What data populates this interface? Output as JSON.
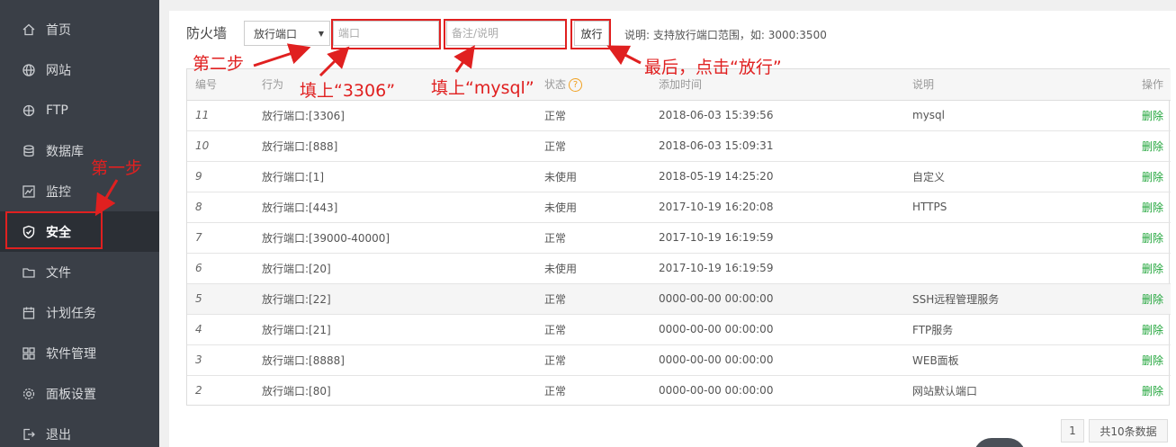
{
  "sidebar": {
    "items": [
      {
        "label": "首页",
        "icon": "home-icon"
      },
      {
        "label": "网站",
        "icon": "globe-icon"
      },
      {
        "label": "FTP",
        "icon": "ftp-icon"
      },
      {
        "label": "数据库",
        "icon": "database-icon"
      },
      {
        "label": "监控",
        "icon": "monitor-icon"
      },
      {
        "label": "安全",
        "icon": "shield-icon",
        "active": true
      },
      {
        "label": "文件",
        "icon": "folder-icon"
      },
      {
        "label": "计划任务",
        "icon": "calendar-icon"
      },
      {
        "label": "软件管理",
        "icon": "grid-icon"
      },
      {
        "label": "面板设置",
        "icon": "gear-icon"
      },
      {
        "label": "退出",
        "icon": "logout-icon"
      }
    ]
  },
  "toolbar": {
    "title": "防火墙",
    "select_value": "放行端口",
    "port_placeholder": "端口",
    "remark_placeholder": "备注/说明",
    "allow_label": "放行",
    "hint": "说明: 支持放行端口范围，如: 3000:3500"
  },
  "table": {
    "headers": [
      "编号",
      "行为",
      "状态",
      "添加时间",
      "说明",
      "操作"
    ],
    "rows": [
      {
        "id": "11",
        "action": "放行端口:[3306]",
        "status": "正常",
        "time": "2018-06-03 15:39:56",
        "remark": "mysql",
        "op": "删除"
      },
      {
        "id": "10",
        "action": "放行端口:[888]",
        "status": "正常",
        "time": "2018-06-03 15:09:31",
        "remark": "",
        "op": "删除"
      },
      {
        "id": "9",
        "action": "放行端口:[1]",
        "status": "未使用",
        "time": "2018-05-19 14:25:20",
        "remark": "自定义",
        "op": "删除"
      },
      {
        "id": "8",
        "action": "放行端口:[443]",
        "status": "未使用",
        "time": "2017-10-19 16:20:08",
        "remark": "HTTPS",
        "op": "删除"
      },
      {
        "id": "7",
        "action": "放行端口:[39000-40000]",
        "status": "正常",
        "time": "2017-10-19 16:19:59",
        "remark": "",
        "op": "删除"
      },
      {
        "id": "6",
        "action": "放行端口:[20]",
        "status": "未使用",
        "time": "2017-10-19 16:19:59",
        "remark": "",
        "op": "删除"
      },
      {
        "id": "5",
        "action": "放行端口:[22]",
        "status": "正常",
        "time": "0000-00-00 00:00:00",
        "remark": "SSH远程管理服务",
        "op": "删除"
      },
      {
        "id": "4",
        "action": "放行端口:[21]",
        "status": "正常",
        "time": "0000-00-00 00:00:00",
        "remark": "FTP服务",
        "op": "删除"
      },
      {
        "id": "3",
        "action": "放行端口:[8888]",
        "status": "正常",
        "time": "0000-00-00 00:00:00",
        "remark": "WEB面板",
        "op": "删除"
      },
      {
        "id": "2",
        "action": "放行端口:[80]",
        "status": "正常",
        "time": "0000-00-00 00:00:00",
        "remark": "网站默认端口",
        "op": "删除"
      }
    ]
  },
  "pagination": {
    "page": "1",
    "total": "共10条数据"
  },
  "annotations": {
    "step1": "第一步",
    "step2": "第二步",
    "fill_port": "填上“3306”",
    "fill_remark": "填上“mysql”",
    "final": "最后，点击“放行”"
  },
  "colors": {
    "accent_green": "#20a53a",
    "annotation_red": "#e02020",
    "sidebar_bg": "#3a3f47"
  }
}
